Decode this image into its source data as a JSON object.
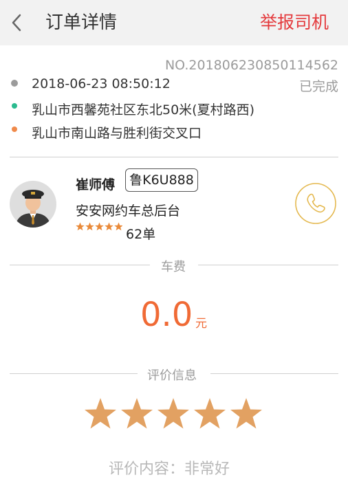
{
  "header": {
    "title": "订单详情",
    "report_label": "举报司机"
  },
  "order": {
    "number": "NO.201806230850114562",
    "time": "2018-06-23 08:50:12",
    "status": "已完成",
    "from": "乳山市西馨苑社区东北50米(夏村路西)",
    "to": "乳山市南山路与胜利街交叉口"
  },
  "driver": {
    "name": "崔师傅",
    "plate": "鲁K6U888",
    "company": "安安网约车总后台",
    "rating_stars": 5,
    "orders_count": "62单"
  },
  "fare": {
    "section_title": "车费",
    "amount": "0.0",
    "unit": "元"
  },
  "rating": {
    "section_title": "评价信息",
    "stars": 5,
    "comment": "评价内容：非常好"
  },
  "colors": {
    "accent_red": "#e4393c",
    "fare_orange": "#f06a35",
    "star_fill": "#e2a162",
    "phone_gold": "#e4b84e",
    "origin_dot": "#2bbb8f",
    "destination_dot": "#f08a4b",
    "time_dot": "#9b9b9b"
  },
  "icons": {
    "back": "chevron-left-icon",
    "clock": "clock-dot-icon",
    "phone": "phone-icon",
    "star": "star-icon",
    "avatar": "driver-avatar"
  }
}
